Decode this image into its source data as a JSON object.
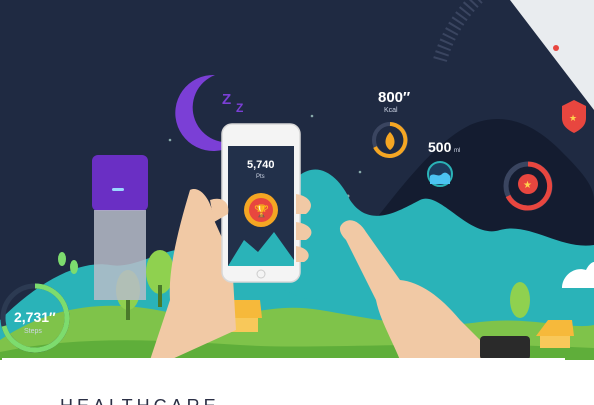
{
  "scene": {
    "phone_points": "5,740",
    "phone_points_unit": "Pts",
    "kcal_value": "800",
    "kcal_suffix": "″",
    "kcal_unit": "Kcal",
    "ml_value": "500",
    "ml_unit": "ml",
    "steps_value": "2,731",
    "steps_suffix": "″",
    "steps_unit": "Steps"
  },
  "footer": {
    "label": "HEALTHCARE"
  },
  "colors": {
    "sky": "#1f2a42",
    "mountain_teal": "#2ab3b8",
    "hills_green": "#7fc34a",
    "moon_purple": "#7b3fd6",
    "accent_orange": "#f5a623",
    "accent_red": "#e8463f"
  }
}
